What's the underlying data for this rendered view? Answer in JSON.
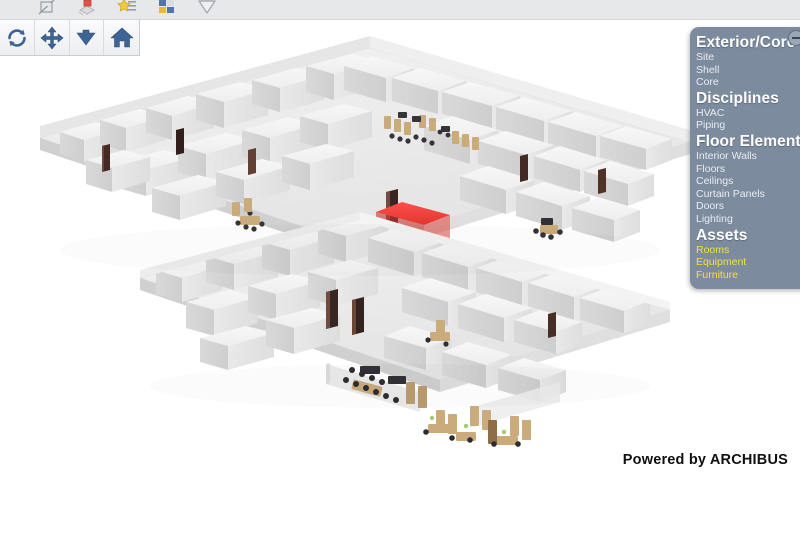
{
  "toolbar": {
    "icons": [
      {
        "name": "hide-selected-icon",
        "label": "Hide Selected"
      },
      {
        "name": "isolate-selected-icon",
        "label": "Isolate Selected"
      },
      {
        "name": "highlight-icon",
        "label": "Highlight"
      },
      {
        "name": "color-legend-icon",
        "label": "Color Legend"
      },
      {
        "name": "select-check-icon",
        "label": "Select"
      }
    ]
  },
  "nav": {
    "buttons": [
      {
        "name": "rotate-button",
        "label": "Rotate",
        "icon": "rotate-icon"
      },
      {
        "name": "pan-button",
        "label": "Pan",
        "icon": "pan-icon"
      },
      {
        "name": "zoom-button",
        "label": "Zoom",
        "icon": "down-arrow-icon"
      },
      {
        "name": "home-button",
        "label": "Home View",
        "icon": "home-icon"
      }
    ]
  },
  "legend": {
    "collapse_label": "−",
    "groups": [
      {
        "title": "Exterior/Core",
        "items": [
          {
            "label": "Site",
            "active": false
          },
          {
            "label": "Shell",
            "active": false
          },
          {
            "label": "Core",
            "active": false
          }
        ]
      },
      {
        "title": "Disciplines",
        "items": [
          {
            "label": "HVAC",
            "active": false
          },
          {
            "label": "Piping",
            "active": false
          }
        ]
      },
      {
        "title": "Floor Elements",
        "items": [
          {
            "label": "Interior Walls",
            "active": false
          },
          {
            "label": "Floors",
            "active": false
          },
          {
            "label": "Ceilings",
            "active": false
          },
          {
            "label": "Curtain Panels",
            "active": false
          },
          {
            "label": "Doors",
            "active": false
          },
          {
            "label": "Lighting",
            "active": false
          }
        ]
      },
      {
        "title": "Assets",
        "items": [
          {
            "label": "Rooms",
            "active": true
          },
          {
            "label": "Equipment",
            "active": true
          },
          {
            "label": "Furniture",
            "active": true
          }
        ]
      }
    ]
  },
  "branding": {
    "text": "Powered by ARCHIBUS"
  },
  "colors": {
    "panel_bg": "#7c8b9e",
    "panel_text": "#e9edf2",
    "panel_active": "#f2e23c",
    "toolbar_bg": "#e6e8e9",
    "canvas_bg": "#ffffff",
    "nav_icon": "#3d6494",
    "highlight_room": "#f23b36",
    "wood": "#c8a97a",
    "door": "#4a2a24"
  },
  "model": {
    "name": "building-floorplan-3d",
    "highlighted_room_color": "#f23b36",
    "view": "isometric"
  }
}
